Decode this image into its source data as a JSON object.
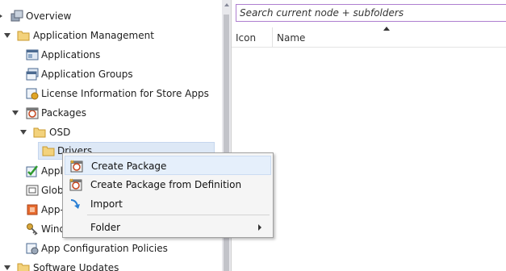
{
  "tree": {
    "items": [
      {
        "label": "Overview"
      },
      {
        "label": "Application Management"
      },
      {
        "label": "Applications"
      },
      {
        "label": "Application Groups"
      },
      {
        "label": "License Information for Store Apps"
      },
      {
        "label": "Packages"
      },
      {
        "label": "OSD"
      },
      {
        "label": "Drivers"
      },
      {
        "label": "Appl"
      },
      {
        "label": "Glob"
      },
      {
        "label": "App-"
      },
      {
        "label": "Wind"
      },
      {
        "label": "App Configuration Policies"
      },
      {
        "label": "Software Updates"
      }
    ]
  },
  "search": {
    "placeholder": "Search current node + subfolders"
  },
  "columns": [
    {
      "label": "Icon"
    },
    {
      "label": "Name"
    }
  ],
  "context_menu": {
    "items": [
      {
        "label": "Create Package"
      },
      {
        "label": "Create Package from Definition"
      },
      {
        "label": "Import"
      },
      {
        "label": "Folder"
      }
    ]
  },
  "colors": {
    "selection": "#dde8f6",
    "search_border": "#ae7fd0",
    "folder": "#e8c35a"
  }
}
